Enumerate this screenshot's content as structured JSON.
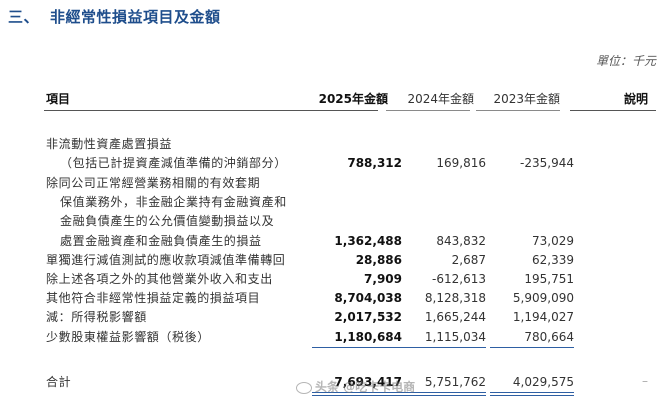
{
  "section": {
    "number": "三、",
    "title": "非經常性損益項目及金額"
  },
  "unit": "單位：千元",
  "headers": {
    "item": "項目",
    "y2025": "2025年金額",
    "y2024": "2024年金額",
    "y2023": "2023年金額",
    "note": "說明"
  },
  "rows": [
    {
      "lines": [
        "非流動性資產處置損益",
        "（包括已計提資產減值準備的沖銷部分）"
      ],
      "v2025": "788,312",
      "v2024": "169,816",
      "v2023": "-235,944"
    },
    {
      "lines": [
        "除同公司正常經營業務相關的有效套期",
        "保值業務外，非金融企業持有金融資產和",
        "金融負債產生的公允價值變動損益以及",
        "處置金融資產和金融負債產生的損益"
      ],
      "v2025": "1,362,488",
      "v2024": "843,832",
      "v2023": "73,029"
    },
    {
      "lines": [
        "單獨進行減值測試的應收款項減值準備轉回"
      ],
      "v2025": "28,886",
      "v2024": "2,687",
      "v2023": "62,339"
    },
    {
      "lines": [
        "除上述各項之外的其他營業外收入和支出"
      ],
      "v2025": "7,909",
      "v2024": "-612,613",
      "v2023": "195,751"
    },
    {
      "lines": [
        "其他符合非經常性損益定義的損益項目"
      ],
      "v2025": "8,704,038",
      "v2024": "8,128,318",
      "v2023": "5,909,090"
    },
    {
      "lines": [
        "減：所得税影響額"
      ],
      "v2025": "2,017,532",
      "v2024": "1,665,244",
      "v2023": "1,194,027"
    },
    {
      "lines": [
        "少數股東權益影響額（税後）"
      ],
      "v2025": "1,180,684",
      "v2024": "1,115,034",
      "v2023": "780,664"
    }
  ],
  "total": {
    "label": "合計",
    "v2025": "7,693,417",
    "v2024": "5,751,762",
    "v2023": "4,029,575",
    "note": "–"
  },
  "watermark": "头条 @吃卡卡电商",
  "colors": {
    "heading": "#1f4e8c",
    "rule": "#2e5fa3"
  }
}
